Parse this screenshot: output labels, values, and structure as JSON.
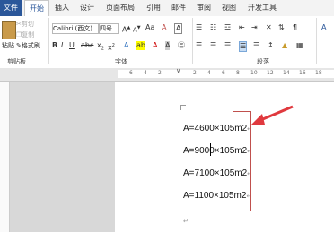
{
  "tabs": [
    "文件",
    "开始",
    "插入",
    "设计",
    "页面布局",
    "引用",
    "邮件",
    "审阅",
    "视图",
    "开发工具"
  ],
  "clipboard": {
    "cut": "剪切",
    "copy": "复制",
    "painter": "格式刷",
    "paste": "粘贴",
    "group": "剪贴板"
  },
  "font": {
    "name": "Calibri (西文)",
    "size": "四号",
    "group": "字体"
  },
  "paragraph": {
    "group": "段落"
  },
  "ruler_numbers": [
    "6",
    "4",
    "2",
    "",
    "2",
    "4",
    "6",
    "8",
    "10",
    "12",
    "14",
    "16",
    "18"
  ],
  "lines": [
    {
      "text": "A=4600×105m2",
      "mark": "↵"
    },
    {
      "text": "A=9000×105m2",
      "mark": "↵"
    },
    {
      "text": "A=7100×105m2",
      "mark": "↵"
    },
    {
      "text": "A=1100×105m2",
      "mark": "↵"
    }
  ],
  "trailing_mark": "↵",
  "accent": "#2b579a",
  "highlight_color": "#c0504d"
}
